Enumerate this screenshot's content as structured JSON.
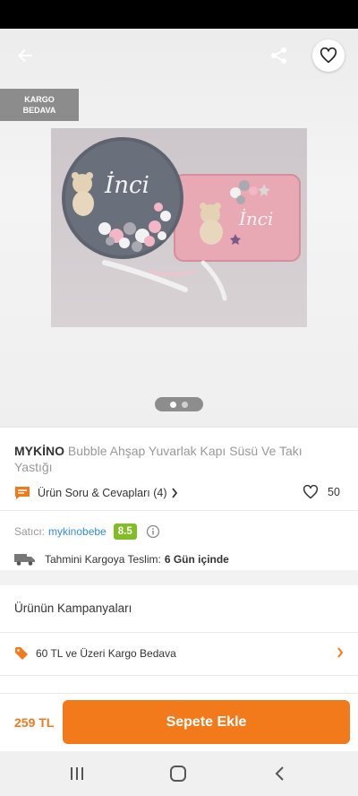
{
  "header": {
    "back_icon": "arrow-left-icon",
    "share_icon": "share-icon",
    "favorite_icon": "heart-outline-icon"
  },
  "badge": {
    "line1": "KARGO",
    "line2": "BEDAVA"
  },
  "gallery": {
    "image_alt": "product photo",
    "pages": 2,
    "current_page": 1
  },
  "product": {
    "brand": "MYKİNO",
    "name": "Bubble Ahşap Yuvarlak Kapı Süsü Ve Takı Yastığı",
    "qa_label": "Ürün Soru & Cevapları (4)",
    "like_count": "50"
  },
  "seller": {
    "label": "Satıcı:",
    "name": "mykinobebe",
    "rating": "8.5"
  },
  "delivery": {
    "label": "Tahmini Kargoya Teslim:",
    "value": "6 Gün içinde"
  },
  "campaigns": {
    "title": "Ürünün Kampanyaları",
    "items": [
      {
        "label": "60 TL ve Üzeri Kargo Bedava"
      }
    ]
  },
  "purchase": {
    "price": "259 TL",
    "button_label": "Sepete Ekle"
  },
  "colors": {
    "accent": "#f27a1a",
    "link": "#2f8fd8",
    "rating": "#82bd28"
  }
}
